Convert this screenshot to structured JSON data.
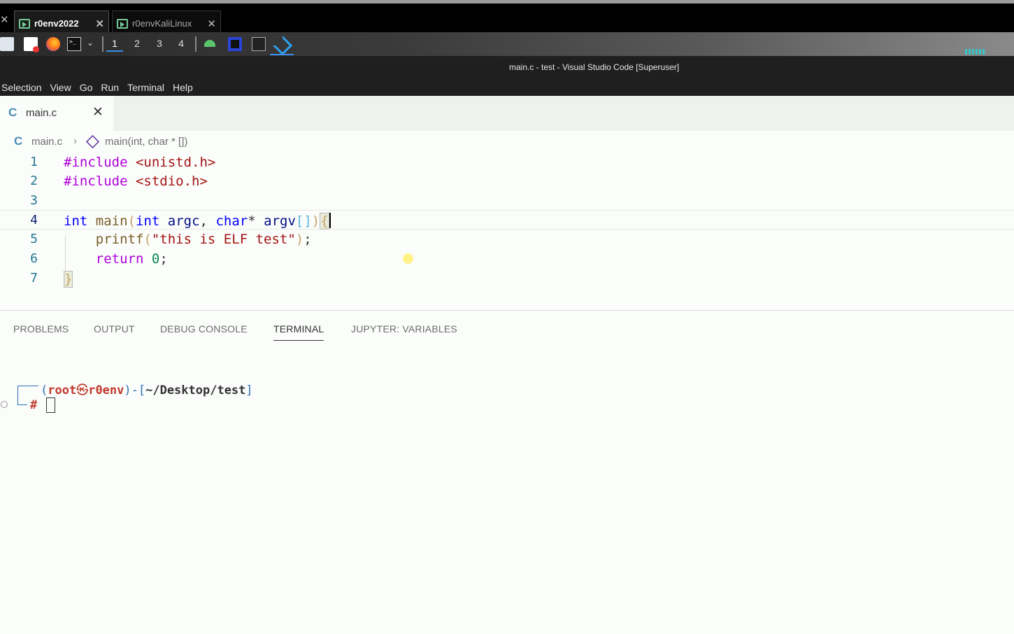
{
  "vm_tabs": [
    {
      "label": "r0env2022",
      "active": true
    },
    {
      "label": "r0envKaliLinux",
      "active": false
    }
  ],
  "taskbar": {
    "workspaces": [
      "1",
      "2",
      "3",
      "4"
    ],
    "active_workspace": "1",
    "apps": [
      "file-manager-icon",
      "text-editor-icon",
      "firefox-icon",
      "terminal-icon",
      "android-studio-icon",
      "jetbrains-icon",
      "terminal-icon",
      "vscode-icon"
    ]
  },
  "window": {
    "title": "main.c - test - Visual Studio Code [Superuser]"
  },
  "menu": [
    "Selection",
    "View",
    "Go",
    "Run",
    "Terminal",
    "Help"
  ],
  "editor": {
    "tab": {
      "icon": "C",
      "name": "main.c"
    },
    "breadcrumb": {
      "file": "main.c",
      "symbol": "main(int, char * [])"
    },
    "lines": [
      {
        "n": "1",
        "text": "#include <unistd.h>"
      },
      {
        "n": "2",
        "text": "#include <stdio.h>"
      },
      {
        "n": "3",
        "text": ""
      },
      {
        "n": "4",
        "text": "int main(int argc, char* argv[]){"
      },
      {
        "n": "5",
        "text": "    printf(\"this is ELF test\");"
      },
      {
        "n": "6",
        "text": "    return 0;"
      },
      {
        "n": "7",
        "text": "}"
      }
    ],
    "active_line": "4"
  },
  "panel": {
    "tabs": [
      "PROBLEMS",
      "OUTPUT",
      "DEBUG CONSOLE",
      "TERMINAL",
      "JUPYTER: VARIABLES"
    ],
    "active_tab": "TERMINAL"
  },
  "terminal": {
    "user": "root",
    "skull": "㉿",
    "host": "r0env",
    "path": "~/Desktop/test",
    "prompt": "#"
  },
  "colors": {
    "accent": "#3b8eea",
    "keyword": "#af00db",
    "string": "#a31515",
    "type": "#0000ff",
    "prompt_red": "#c0392b"
  }
}
